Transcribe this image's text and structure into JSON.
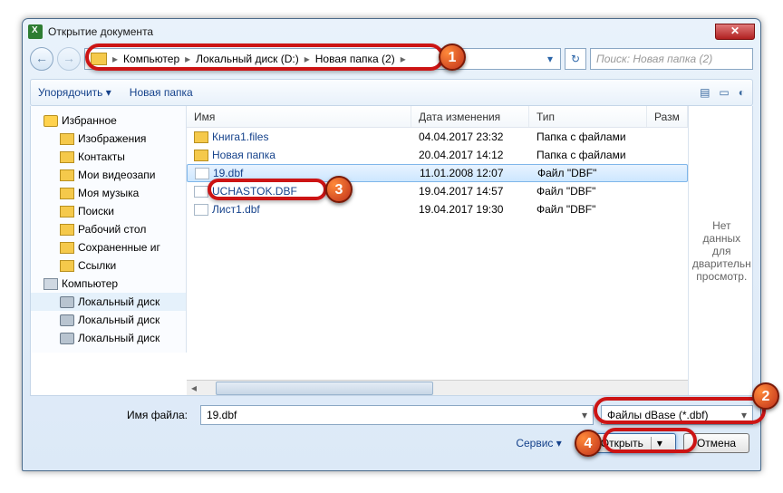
{
  "title": "Открытие документа",
  "nav": {
    "crumbs": [
      "Компьютер",
      "Локальный диск (D:)",
      "Новая папка (2)"
    ],
    "search_placeholder": "Поиск: Новая папка (2)"
  },
  "toolbar": {
    "organize": "Упорядочить",
    "newfolder": "Новая папка"
  },
  "tree": {
    "items": [
      {
        "label": "Избранное",
        "cls": "star",
        "lvl": 0
      },
      {
        "label": "Изображения",
        "cls": "",
        "lvl": 1
      },
      {
        "label": "Контакты",
        "cls": "",
        "lvl": 1
      },
      {
        "label": "Мои видеозапи",
        "cls": "",
        "lvl": 1
      },
      {
        "label": "Моя музыка",
        "cls": "",
        "lvl": 1
      },
      {
        "label": "Поиски",
        "cls": "",
        "lvl": 1
      },
      {
        "label": "Рабочий стол",
        "cls": "",
        "lvl": 1
      },
      {
        "label": "Сохраненные иг",
        "cls": "",
        "lvl": 1
      },
      {
        "label": "Ссылки",
        "cls": "",
        "lvl": 1
      },
      {
        "label": "Компьютер",
        "cls": "pc",
        "lvl": 0
      },
      {
        "label": "Локальный диск",
        "cls": "disk",
        "lvl": 1,
        "sel": true
      },
      {
        "label": "Локальный диск",
        "cls": "disk",
        "lvl": 1
      },
      {
        "label": "Локальный диск",
        "cls": "disk",
        "lvl": 1
      }
    ]
  },
  "columns": {
    "name": "Имя",
    "date": "Дата изменения",
    "type": "Тип",
    "size": "Разм"
  },
  "files": [
    {
      "name": "Книга1.files",
      "date": "04.04.2017 23:32",
      "type": "Папка с файлами",
      "kind": "folder"
    },
    {
      "name": "Новая папка",
      "date": "20.04.2017 14:12",
      "type": "Папка с файлами",
      "kind": "folder"
    },
    {
      "name": "19.dbf",
      "date": "11.01.2008 12:07",
      "type": "Файл \"DBF\"",
      "kind": "file",
      "sel": true
    },
    {
      "name": "UCHASTOK.DBF",
      "date": "19.04.2017 14:57",
      "type": "Файл \"DBF\"",
      "kind": "file"
    },
    {
      "name": "Лист1.dbf",
      "date": "19.04.2017 19:30",
      "type": "Файл \"DBF\"",
      "kind": "file"
    }
  ],
  "preview": "Нет данных для дварительн просмотр.",
  "footer": {
    "filename_label": "Имя файла:",
    "filename_value": "19.dbf",
    "filter": "Файлы dBase (*.dbf)",
    "service": "Сервис",
    "open": "Открыть",
    "cancel": "Отмена"
  },
  "markers": [
    "1",
    "2",
    "3",
    "4"
  ]
}
